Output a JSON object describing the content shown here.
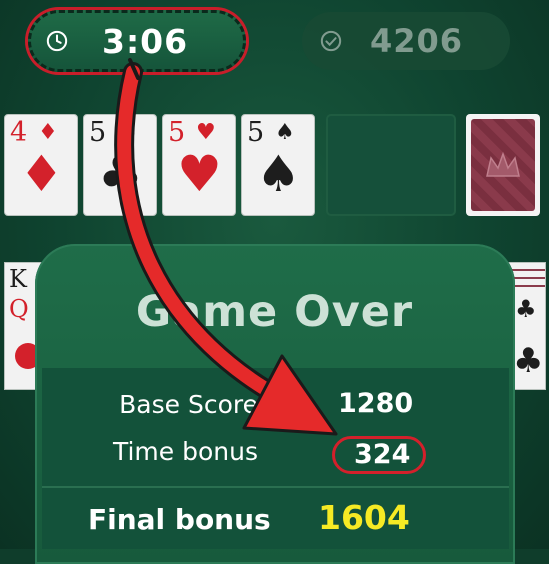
{
  "top_bar": {
    "timer": "3:06",
    "timer_icon": "clock-icon",
    "score": "4206",
    "score_icon": "checkmark-circle-icon"
  },
  "foundation": [
    {
      "rank": "4",
      "suit": "♦",
      "color": "#d3212b"
    },
    {
      "rank": "5",
      "suit": "♣",
      "color": "#1d1d1d"
    },
    {
      "rank": "5",
      "suit": "♥",
      "color": "#d3212b"
    },
    {
      "rank": "5",
      "suit": "♠",
      "color": "#1d1d1d"
    }
  ],
  "tableau_partial": {
    "left_ranks": [
      "K",
      "Q"
    ],
    "right_suit": "♣"
  },
  "dialog": {
    "title": "Game Over",
    "base_score_label": "Base Score",
    "base_score_value": "1280",
    "time_bonus_label": "Time bonus",
    "time_bonus_value": "324",
    "final_label": "Final bonus",
    "final_value": "1604"
  },
  "colors": {
    "highlight": "#d4202b",
    "final_value": "#f6ea24",
    "table": "#0f4430"
  }
}
